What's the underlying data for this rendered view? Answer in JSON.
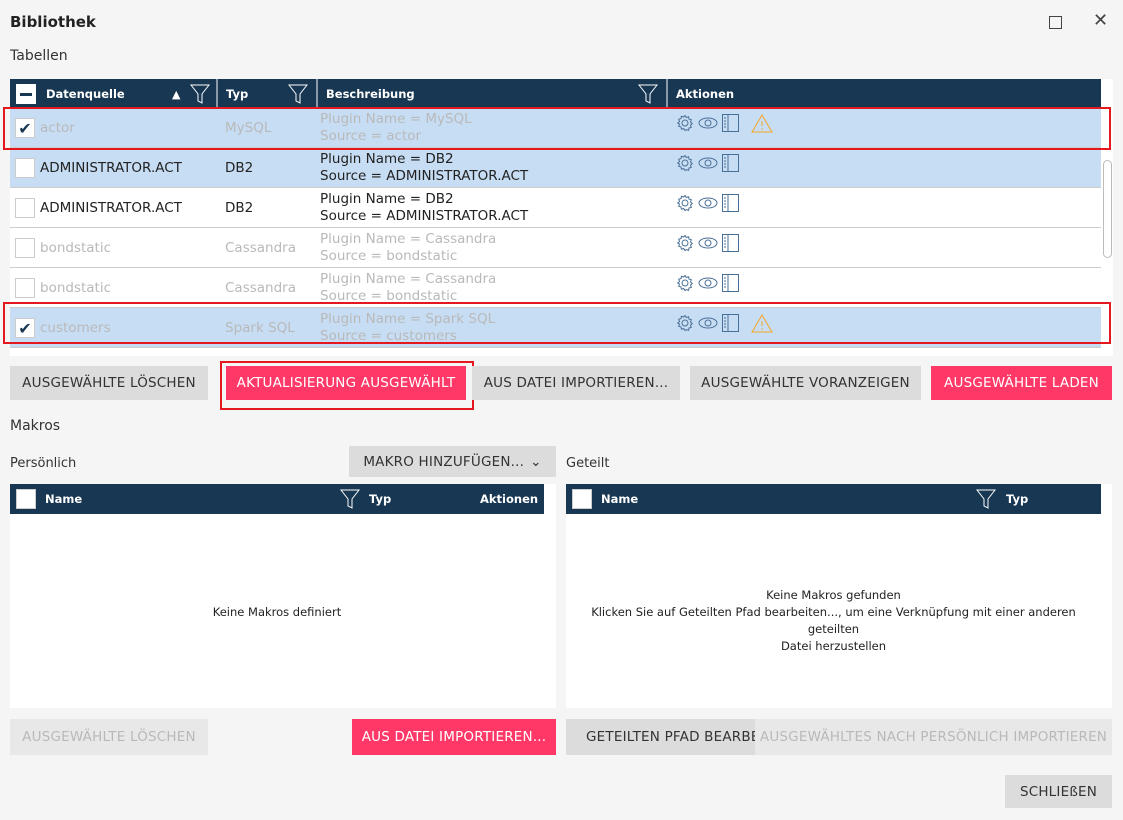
{
  "window": {
    "title": "Bibliothek",
    "maximize_icon": "square-icon",
    "close_icon": "x-icon"
  },
  "tables": {
    "section_label": "Tabellen",
    "columns": [
      "Datenquelle",
      "Typ",
      "Beschreibung",
      "Aktionen"
    ],
    "rows": [
      {
        "name": "actor",
        "type": "MySQL",
        "desc1": "Plugin Name = MySQL",
        "desc2": "Source = actor",
        "checked": true,
        "enabled": false,
        "selected": true,
        "warning": true
      },
      {
        "name": "ADMINISTRATOR.ACT",
        "type": "DB2",
        "desc1": "Plugin Name = DB2",
        "desc2": "Source = ADMINISTRATOR.ACT",
        "checked": false,
        "enabled": true,
        "selected": true,
        "warning": false
      },
      {
        "name": "ADMINISTRATOR.ACT",
        "type": "DB2",
        "desc1": "Plugin Name = DB2",
        "desc2": "Source = ADMINISTRATOR.ACT",
        "checked": false,
        "enabled": true,
        "selected": false,
        "warning": false
      },
      {
        "name": "bondstatic",
        "type": "Cassandra",
        "desc1": "Plugin Name = Cassandra",
        "desc2": "Source = bondstatic",
        "checked": false,
        "enabled": false,
        "selected": false,
        "warning": false
      },
      {
        "name": "bondstatic",
        "type": "Cassandra",
        "desc1": "Plugin Name = Cassandra",
        "desc2": "Source = bondstatic",
        "checked": false,
        "enabled": false,
        "selected": false,
        "warning": false
      },
      {
        "name": "customers",
        "type": "Spark SQL",
        "desc1": "Plugin Name = Spark SQL",
        "desc2": "Source = customers",
        "checked": true,
        "enabled": false,
        "selected": true,
        "warning": true
      }
    ],
    "buttons": {
      "delete": "AUSGEWÄHLTE LÖSCHEN",
      "update": "AKTUALISIERUNG AUSGEWÄHLT",
      "import": "AUS DATEI IMPORTIEREN...",
      "preview": "AUSGEWÄHLTE VORANZEIGEN",
      "load": "AUSGEWÄHLTE LADEN"
    }
  },
  "macros": {
    "section_label": "Makros",
    "personal": {
      "label": "Persönlich",
      "add_button": "MAKRO HINZUFÜGEN...",
      "columns": [
        "Name",
        "Typ",
        "Aktionen"
      ],
      "empty": "Keine Makros definiert",
      "delete_button": "AUSGEWÄHLTE LÖSCHEN",
      "import_button": "AUS DATEI IMPORTIEREN..."
    },
    "shared": {
      "label": "Geteilt",
      "columns": [
        "Name",
        "Typ"
      ],
      "empty1": "Keine Makros gefunden",
      "empty2": "Klicken Sie auf Geteilten Pfad bearbeiten..., um eine Verknüpfung mit einer anderen geteilten",
      "empty3": "Datei herzustellen",
      "edit_path_button": "GETEILTEN PFAD BEARBEITEN...",
      "import_button": "AUSGEWÄHLTES NACH PERSÖNLICH IMPORTIEREN"
    }
  },
  "close_button": "SCHLIEßEN",
  "colors": {
    "header": "#173753",
    "selected_row": "#c7ddf4",
    "accent": "#ff3867",
    "highlight_box": "#e3191f",
    "warning": "#f5a623"
  }
}
